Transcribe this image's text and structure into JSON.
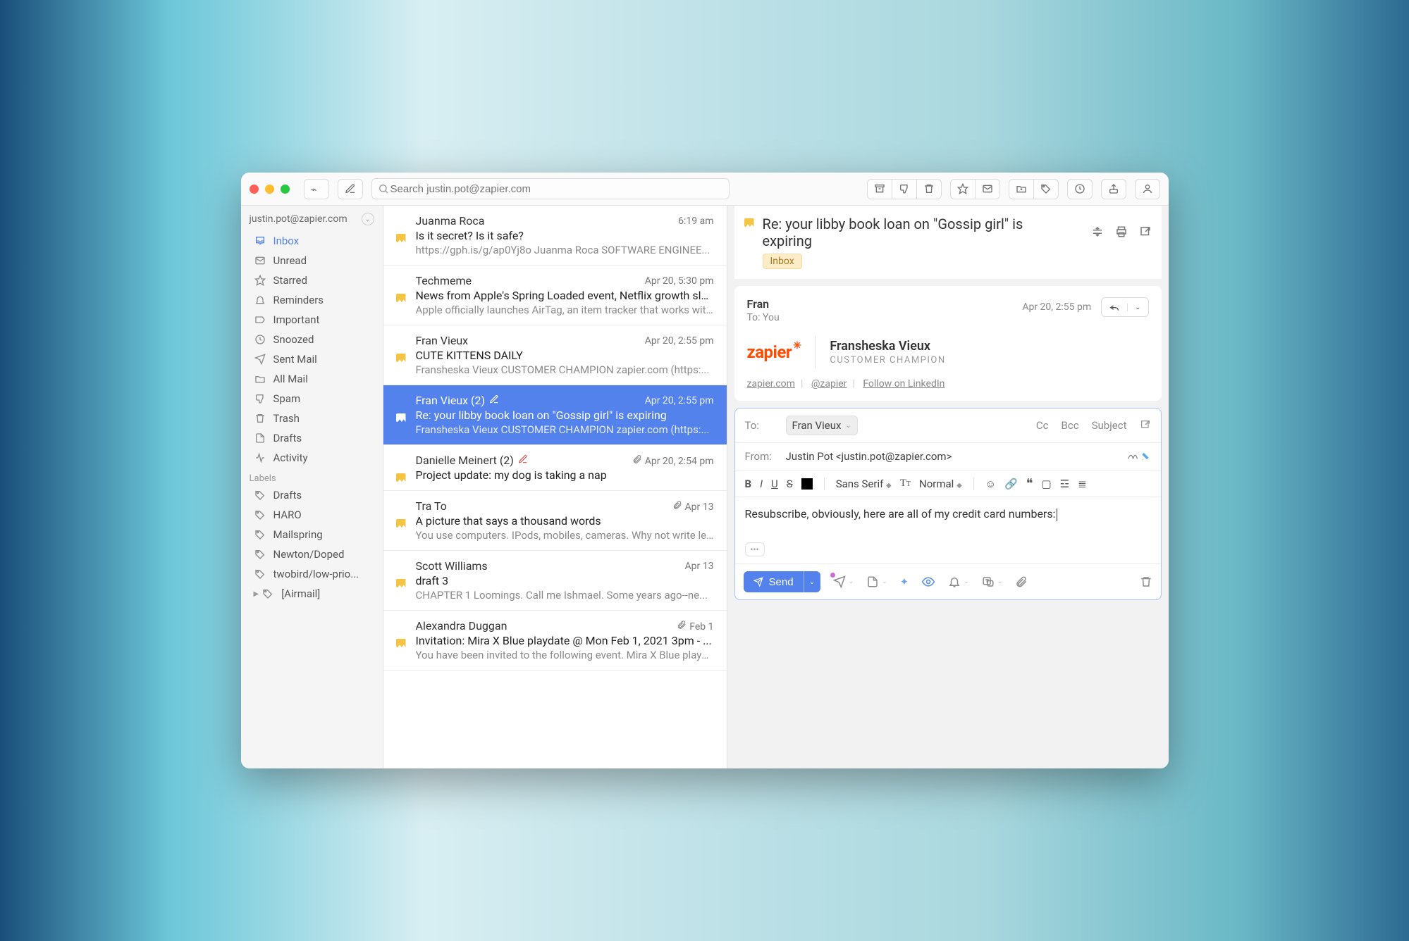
{
  "account_email": "justin.pot@zapier.com",
  "search_placeholder": "Search justin.pot@zapier.com",
  "sidebar": {
    "folders": [
      {
        "label": "Inbox",
        "icon": "inbox"
      },
      {
        "label": "Unread",
        "icon": "mail"
      },
      {
        "label": "Starred",
        "icon": "star"
      },
      {
        "label": "Reminders",
        "icon": "bell"
      },
      {
        "label": "Important",
        "icon": "label"
      },
      {
        "label": "Snoozed",
        "icon": "clock"
      },
      {
        "label": "Sent Mail",
        "icon": "send"
      },
      {
        "label": "All Mail",
        "icon": "folder"
      },
      {
        "label": "Spam",
        "icon": "thumbs-down"
      },
      {
        "label": "Trash",
        "icon": "trash"
      },
      {
        "label": "Drafts",
        "icon": "file"
      },
      {
        "label": "Activity",
        "icon": "activity"
      }
    ],
    "labels_header": "Labels",
    "labels": [
      {
        "label": "Drafts"
      },
      {
        "label": "HARO"
      },
      {
        "label": "Mailspring"
      },
      {
        "label": "Newton/Doped"
      },
      {
        "label": "twobird/low-prio..."
      },
      {
        "label": "[Airmail]",
        "expandable": true
      }
    ]
  },
  "messages": [
    {
      "from": "Juanma Roca",
      "when": "6:19 am",
      "subject": "Is it secret? Is it safe?",
      "preview": "https://gph.is/g/ap0Yj8o Juanma Roca SOFTWARE ENGINEE..."
    },
    {
      "from": "Techmeme",
      "when": "Apr 20, 5:30 pm",
      "subject": "News from Apple's Spring Loaded event, Netflix growth slo...",
      "preview": "Apple officially launches AirTag, an item tracker that works wit..."
    },
    {
      "from": "Fran Vieux",
      "when": "Apr 20, 2:55 pm",
      "subject": "CUTE KITTENS DAILY",
      "preview": "Fransheska Vieux CUSTOMER CHAMPION zapier.com (https:..."
    },
    {
      "from": "Fran Vieux (2)",
      "when": "Apr 20, 2:55 pm",
      "subject": "Re: your libby book loan on \"Gossip girl\" is expiring",
      "preview": "Fransheska Vieux CUSTOMER CHAMPION zapier.com (https:...",
      "draft": true,
      "selected": true
    },
    {
      "from": "Danielle Meinert (2)",
      "when": "Apr 20, 2:54 pm",
      "subject": "Project update: my dog is taking a nap",
      "preview": "",
      "draft": true,
      "attachment": true
    },
    {
      "from": "Tra To",
      "when": "Apr 13",
      "subject": "A picture that says a thousand words",
      "preview": "You use computers. IPods, mobiles, cameras. Why not write le...",
      "attachment": true
    },
    {
      "from": "Scott Williams",
      "when": "Apr 13",
      "subject": "draft 3",
      "preview": "CHAPTER 1 Loomings. Call me Ishmael. Some years ago--ne..."
    },
    {
      "from": "Alexandra Duggan",
      "when": "Feb 1",
      "subject": "Invitation: Mira X Blue playdate @ Mon Feb 1, 2021 3pm - ...",
      "preview": "You have been invited to the following event. Mira X Blue playd...",
      "attachment": true
    }
  ],
  "reader": {
    "title": "Re: your libby book loan on \"Gossip girl\" is expiring",
    "tag": "Inbox",
    "message": {
      "from": "Fran",
      "to": "To: You",
      "when": "Apr 20, 2:55 pm",
      "sig_name": "Fransheska Vieux",
      "sig_title": "CUSTOMER CHAMPION",
      "sig_logo": "zapier",
      "links": {
        "site": "zapier.com",
        "twitter": "@zapier",
        "linkedin": "Follow on LinkedIn"
      }
    }
  },
  "compose": {
    "to_label": "To:",
    "to_chip": "Fran Vieux",
    "cc": "Cc",
    "bcc": "Bcc",
    "subject": "Subject",
    "from_label": "From:",
    "from_value": "Justin Pot <justin.pot@zapier.com>",
    "font_family": "Sans Serif",
    "font_size": "Normal",
    "body": "Resubscribe, obviously, here are all of my credit card numbers:",
    "send_label": "Send"
  }
}
